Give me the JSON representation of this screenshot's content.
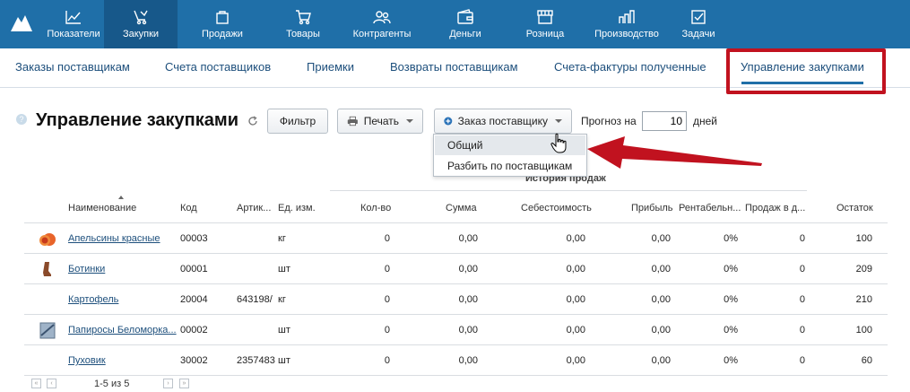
{
  "topnav": {
    "items": [
      {
        "label": "Показатели",
        "icon": "chart-icon"
      },
      {
        "label": "Закупки",
        "icon": "purchase-icon"
      },
      {
        "label": "Продажи",
        "icon": "bag-icon"
      },
      {
        "label": "Товары",
        "icon": "cart-icon"
      },
      {
        "label": "Контрагенты",
        "icon": "people-icon"
      },
      {
        "label": "Деньги",
        "icon": "wallet-icon"
      },
      {
        "label": "Розница",
        "icon": "shop-icon"
      },
      {
        "label": "Производство",
        "icon": "factory-icon"
      },
      {
        "label": "Задачи",
        "icon": "checkbox-icon"
      }
    ],
    "active_index": 1,
    "color": "#1f6fa8",
    "active_color": "#17588a"
  },
  "subnav": {
    "tabs": [
      "Заказы поставщикам",
      "Счета поставщиков",
      "Приемки",
      "Возвраты поставщикам",
      "Счета-фактуры полученные",
      "Управление закупками"
    ],
    "active_index": 5
  },
  "header": {
    "title": "Управление закупками",
    "filter_label": "Фильтр",
    "print_label": "Печать",
    "order_label": "Заказ поставщику",
    "forecast_label": "Прогноз на",
    "forecast_value": "10",
    "days_label": "дней"
  },
  "dropdown": {
    "items": [
      "Общий",
      "Разбить по поставщикам"
    ],
    "hover_index": 0
  },
  "table": {
    "group_label": "История продаж",
    "columns": [
      "Наименование",
      "Код",
      "Артик...",
      "Ед. изм.",
      "Кол-во",
      "Сумма",
      "Себестоимость",
      "Прибыль",
      "Рентабельн...",
      "Продаж в д...",
      "Остаток"
    ],
    "rows": [
      {
        "name": "Апельсины красные",
        "code": "00003",
        "article": "",
        "unit": "кг",
        "qty": "0",
        "sum": "0,00",
        "cost": "0,00",
        "profit": "0,00",
        "margin": "0%",
        "per_day": "0",
        "stock": "100",
        "thumb": "orange"
      },
      {
        "name": "Ботинки",
        "code": "00001",
        "article": "",
        "unit": "шт",
        "qty": "0",
        "sum": "0,00",
        "cost": "0,00",
        "profit": "0,00",
        "margin": "0%",
        "per_day": "0",
        "stock": "209",
        "thumb": "boot"
      },
      {
        "name": "Картофель",
        "code": "20004",
        "article": "643198/",
        "unit": "кг",
        "qty": "0",
        "sum": "0,00",
        "cost": "0,00",
        "profit": "0,00",
        "margin": "0%",
        "per_day": "0",
        "stock": "210",
        "thumb": ""
      },
      {
        "name": "Папиросы Беломорка...",
        "code": "00002",
        "article": "",
        "unit": "шт",
        "qty": "0",
        "sum": "0,00",
        "cost": "0,00",
        "profit": "0,00",
        "margin": "0%",
        "per_day": "0",
        "stock": "100",
        "thumb": "pack"
      },
      {
        "name": "Пуховик",
        "code": "30002",
        "article": "2357483",
        "unit": "шт",
        "qty": "0",
        "sum": "0,00",
        "cost": "0,00",
        "profit": "0,00",
        "margin": "0%",
        "per_day": "0",
        "stock": "60",
        "thumb": ""
      }
    ]
  },
  "pager": {
    "text": "1-5 из 5"
  }
}
